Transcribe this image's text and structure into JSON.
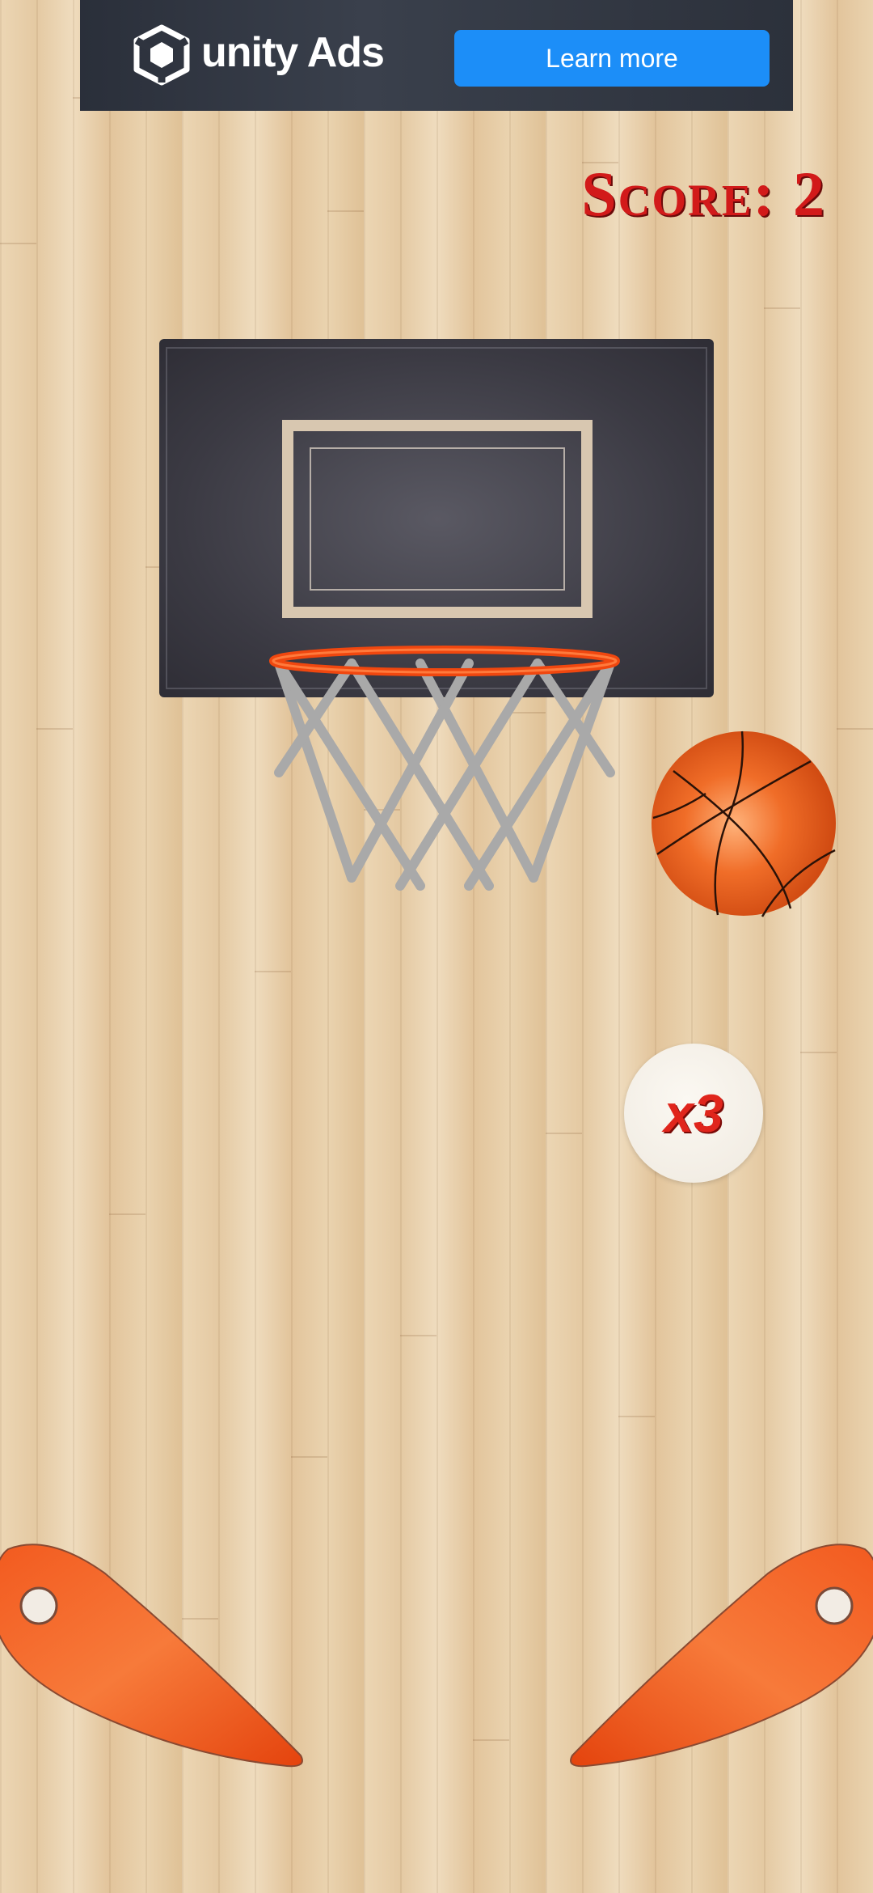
{
  "ad": {
    "brand": "unity Ads",
    "button_label": "Learn more",
    "logo_icon": "unity-logo-icon",
    "button_color": "#1c8ef8"
  },
  "hud": {
    "score_label": "Score: 2",
    "score_color": "#d21a1a"
  },
  "game": {
    "multiplier_label": "x3",
    "ball_icon": "basketball-icon",
    "hoop_icon": "basketball-hoop-icon",
    "flipper_color": "#f04a12"
  }
}
